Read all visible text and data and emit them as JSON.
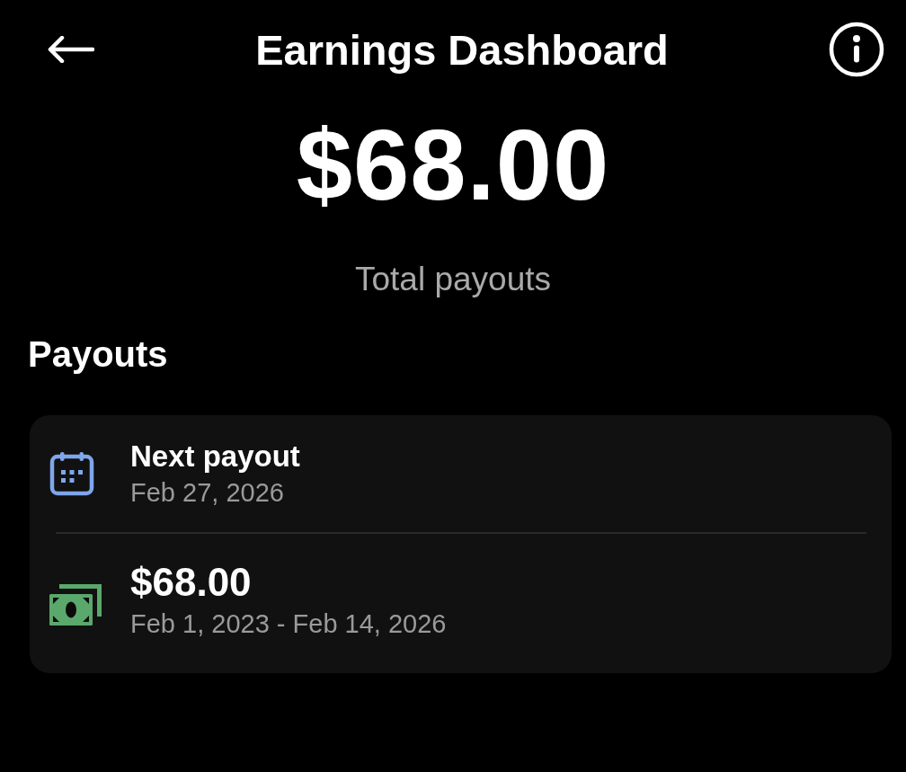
{
  "header": {
    "title": "Earnings Dashboard"
  },
  "summary": {
    "amount": "$68.00",
    "label": "Total payouts"
  },
  "payouts": {
    "heading": "Payouts",
    "items": [
      {
        "kind": "date",
        "title": "Next payout",
        "subtitle": "Feb 27, 2026"
      },
      {
        "kind": "amount",
        "title": "$68.00",
        "subtitle": "Feb 1, 2023 - Feb 14, 2026"
      }
    ]
  }
}
